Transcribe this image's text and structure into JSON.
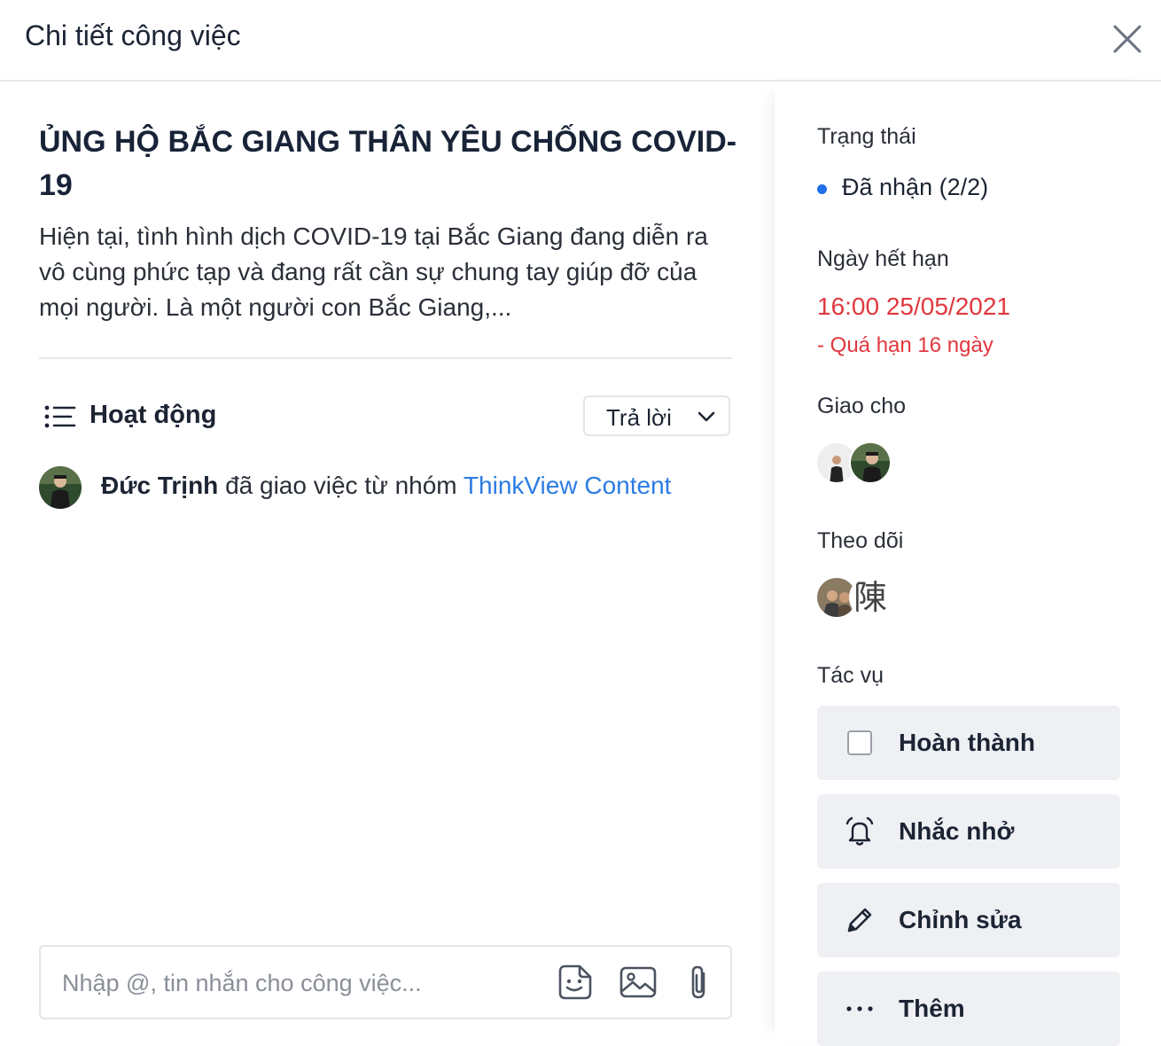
{
  "header": {
    "title": "Chi tiết công việc"
  },
  "task": {
    "title": "ỦNG HỘ BẮC GIANG THÂN YÊU CHỐNG COVID-19",
    "description": "Hiện tại, tình hình dịch COVID-19 tại Bắc Giang đang diễn ra vô cùng phức tạp và đang rất cần sự chung tay giúp đỡ của mọi người. Là một người con Bắc Giang,..."
  },
  "activity": {
    "title": "Hoạt động",
    "reply_dropdown": {
      "selected": "Trả lời"
    },
    "items": [
      {
        "user": "Đức Trịnh",
        "action": "đã giao việc từ nhóm",
        "group": "ThinkView Content"
      }
    ]
  },
  "composer": {
    "placeholder": "Nhập @, tin nhắn cho công việc..."
  },
  "sidebar": {
    "status": {
      "label": "Trạng thái",
      "value": "Đã nhận (2/2)",
      "dot_color": "#1f6fe8"
    },
    "due": {
      "label": "Ngày hết hạn",
      "value": "16:00 25/05/2021",
      "overdue": "- Quá hạn 16 ngày",
      "color": "#e0383e"
    },
    "assignees": {
      "label": "Giao cho"
    },
    "followers": {
      "label": "Theo dõi",
      "glyph": "陳"
    },
    "actions": {
      "label": "Tác vụ",
      "items": [
        {
          "label": "Hoàn thành",
          "icon": "checkbox-icon"
        },
        {
          "label": "Nhắc nhở",
          "icon": "alarm-icon"
        },
        {
          "label": "Chỉnh sửa",
          "icon": "pencil-icon"
        },
        {
          "label": "Thêm",
          "icon": "more-dots-icon"
        }
      ]
    }
  }
}
